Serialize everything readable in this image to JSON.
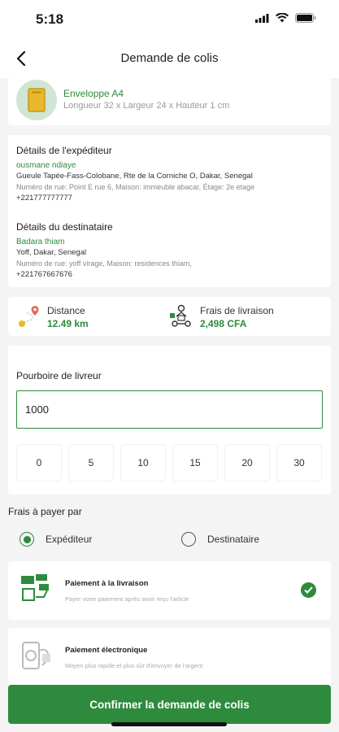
{
  "status_bar": {
    "time": "5:18"
  },
  "header": {
    "title": "Demande de colis"
  },
  "package": {
    "name": "Enveloppe A4",
    "dimensions": "Longueur 32 x Largeur 24 x  Hauteur 1 cm"
  },
  "sender": {
    "section_title": "Détails de l'expéditeur",
    "name": "ousmane ndiaye",
    "address": "Gueule Tapée-Fass-Colobane, Rte de la Corniche O, Dakar, Senegal",
    "details": "Numéro de rue: Point E rue 6, Maison: immeuble abacar, Étage: 2e etage",
    "phone": "+221777777777"
  },
  "recipient": {
    "section_title": "Détails du destinataire",
    "name": "Badara thiam",
    "address": "Yoff, Dakar, Senegal",
    "details": "Numéro de rue: yoff virage, Maison: residences thiam,",
    "phone": "+221767667676"
  },
  "fees": {
    "distance_label": "Distance",
    "distance_value": "12.49 km",
    "delivery_label": "Frais de livraison",
    "delivery_value": "2,498 CFA"
  },
  "tip": {
    "title": "Pourboire de livreur",
    "value": "1000",
    "chips": [
      "0",
      "5",
      "10",
      "15",
      "20",
      "30"
    ]
  },
  "pay_by": {
    "title": "Frais à payer par",
    "option_sender": "Expéditeur",
    "option_recipient": "Destinataire",
    "selected": "Expéditeur"
  },
  "methods": [
    {
      "title": "Paiement à la livraison",
      "subtitle": "Payer votre paiement après avoir reçu l'article",
      "selected": true
    },
    {
      "title": "Paiement électronique",
      "subtitle": "Moyen plus rapide et plus sûr d'envoyer de l'argent",
      "selected": false
    }
  ],
  "confirm_label": "Confirmer la demande de colis",
  "colors": {
    "accent": "#2e8b3d",
    "background": "#f4f4f4"
  }
}
